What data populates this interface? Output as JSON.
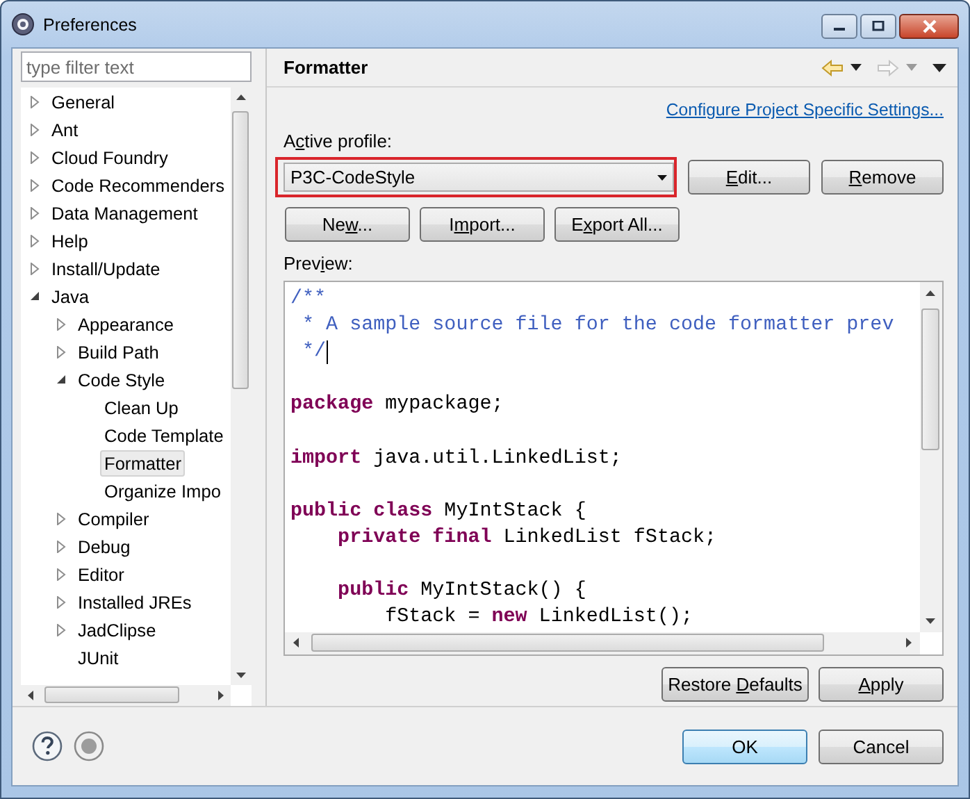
{
  "window": {
    "title": "Preferences"
  },
  "filter": {
    "placeholder": "type filter text"
  },
  "tree": [
    {
      "label": "General",
      "kind": "folder",
      "expanded": false,
      "selected": false
    },
    {
      "label": "Ant",
      "kind": "folder",
      "expanded": false,
      "selected": false
    },
    {
      "label": "Cloud Foundry",
      "kind": "folder",
      "expanded": false,
      "selected": false
    },
    {
      "label": "Code Recommenders",
      "kind": "folder",
      "expanded": false,
      "selected": false
    },
    {
      "label": "Data Management",
      "kind": "folder",
      "expanded": false,
      "selected": false
    },
    {
      "label": "Help",
      "kind": "folder",
      "expanded": false,
      "selected": false
    },
    {
      "label": "Install/Update",
      "kind": "folder",
      "expanded": false,
      "selected": false
    },
    {
      "label": "Java",
      "kind": "folder",
      "expanded": true,
      "selected": false,
      "children": [
        {
          "label": "Appearance",
          "kind": "folder",
          "expanded": false,
          "selected": false
        },
        {
          "label": "Build Path",
          "kind": "folder",
          "expanded": false,
          "selected": false
        },
        {
          "label": "Code Style",
          "kind": "folder",
          "expanded": true,
          "selected": false,
          "children": [
            {
              "label": "Clean Up",
              "kind": "leaf",
              "selected": false
            },
            {
              "label": "Code Template",
              "kind": "leaf",
              "selected": false
            },
            {
              "label": "Formatter",
              "kind": "leaf",
              "selected": true
            },
            {
              "label": "Organize Impo",
              "kind": "leaf",
              "selected": false
            }
          ]
        },
        {
          "label": "Compiler",
          "kind": "folder",
          "expanded": false,
          "selected": false
        },
        {
          "label": "Debug",
          "kind": "folder",
          "expanded": false,
          "selected": false
        },
        {
          "label": "Editor",
          "kind": "folder",
          "expanded": false,
          "selected": false
        },
        {
          "label": "Installed JREs",
          "kind": "folder",
          "expanded": false,
          "selected": false
        },
        {
          "label": "JadClipse",
          "kind": "folder",
          "expanded": false,
          "selected": false
        },
        {
          "label": "JUnit",
          "kind": "leaf",
          "selected": false
        }
      ]
    }
  ],
  "page": {
    "title": "Formatter",
    "link": "Configure Project Specific Settings...",
    "profile_label": {
      "before": "A",
      "key": "c",
      "after": "tive profile:"
    },
    "profile": {
      "value": "P3C-CodeStyle",
      "highlighted": true
    },
    "profile_buttons": [
      {
        "key": "E",
        "after": "dit..."
      },
      {
        "key": "R",
        "after": "emove"
      }
    ],
    "buttons": [
      {
        "before": "Ne",
        "key": "w",
        "after": "..."
      },
      {
        "before": "I",
        "key": "m",
        "after": "port..."
      },
      {
        "before": "E",
        "key": "x",
        "after": "port All..."
      }
    ],
    "preview_label": {
      "before": "Prev",
      "key": "i",
      "after": "ew:"
    },
    "preview": [
      {
        "kind": "code",
        "segments": [
          {
            "kind": "comment",
            "text": "/**"
          }
        ]
      },
      {
        "kind": "code",
        "segments": [
          {
            "kind": "comment",
            "text": " * A sample source file for the code formatter prev"
          }
        ]
      },
      {
        "kind": "code",
        "segments": [
          {
            "kind": "comment",
            "text": " */"
          }
        ],
        "caret": true
      },
      {
        "kind": "blank"
      },
      {
        "kind": "code",
        "segments": [
          {
            "kind": "keyword",
            "text": "package"
          },
          {
            "kind": "plain",
            "text": " mypackage;"
          }
        ]
      },
      {
        "kind": "blank"
      },
      {
        "kind": "code",
        "segments": [
          {
            "kind": "keyword",
            "text": "import"
          },
          {
            "kind": "plain",
            "text": " java.util.LinkedList;"
          }
        ]
      },
      {
        "kind": "blank"
      },
      {
        "kind": "code",
        "segments": [
          {
            "kind": "keyword",
            "text": "public class"
          },
          {
            "kind": "plain",
            "text": " MyIntStack {"
          }
        ]
      },
      {
        "kind": "code",
        "segments": [
          {
            "kind": "keyword",
            "text": "    private final"
          },
          {
            "kind": "plain",
            "text": " LinkedList fStack;"
          }
        ]
      },
      {
        "kind": "blank"
      },
      {
        "kind": "code",
        "segments": [
          {
            "kind": "keyword",
            "text": "    public"
          },
          {
            "kind": "plain",
            "text": " MyIntStack() {"
          }
        ]
      },
      {
        "kind": "code",
        "segments": [
          {
            "kind": "plain",
            "text": "        fStack = "
          },
          {
            "kind": "keyword",
            "text": "new"
          },
          {
            "kind": "plain",
            "text": " LinkedList();"
          }
        ]
      }
    ],
    "bottom_buttons": [
      {
        "before": "Restore ",
        "key": "D",
        "after": "efaults"
      },
      {
        "key": "A",
        "after": "pply"
      }
    ]
  },
  "dialog_buttons": [
    {
      "label": "OK",
      "default": true
    },
    {
      "label": "Cancel",
      "default": false
    }
  ]
}
